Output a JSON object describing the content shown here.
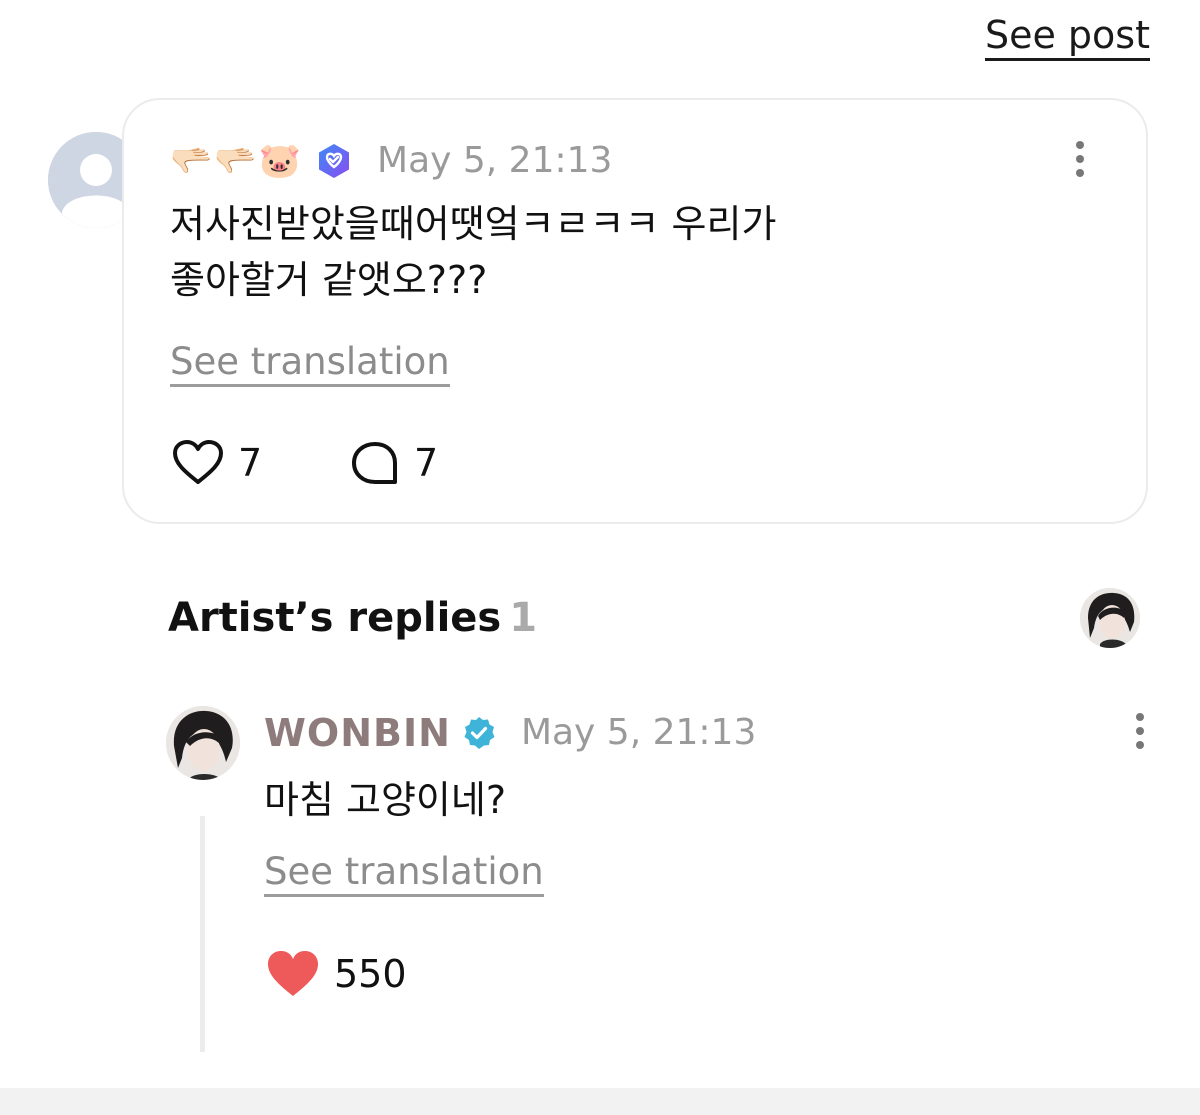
{
  "header": {
    "see_post_label": "See post"
  },
  "comment": {
    "author_emoji": "🫳🏻🫳🏻🐷",
    "badge_icon": "verified-membership-icon",
    "timestamp": "May 5, 21:13",
    "text_line1": "저사진받았을때어땟엌ㅋㄹㅋㅋ 우리가",
    "text_line2": "좋아할거 같앳오???",
    "see_translation_label": "See translation",
    "likes": "7",
    "replies": "7"
  },
  "artist_replies": {
    "title": "Artist’s replies",
    "count": "1"
  },
  "reply": {
    "author": "WONBIN",
    "timestamp": "May 5, 21:13",
    "text": "마침 고양이네?",
    "see_translation_label": "See translation",
    "likes": "550"
  },
  "colors": {
    "artist_name": "#8e7b7b",
    "heart_filled": "#ee5a5a",
    "verified_badge": "#3fb4d8",
    "membership_badge": "#6a5cf2",
    "muted_text": "#8c8c8c"
  }
}
